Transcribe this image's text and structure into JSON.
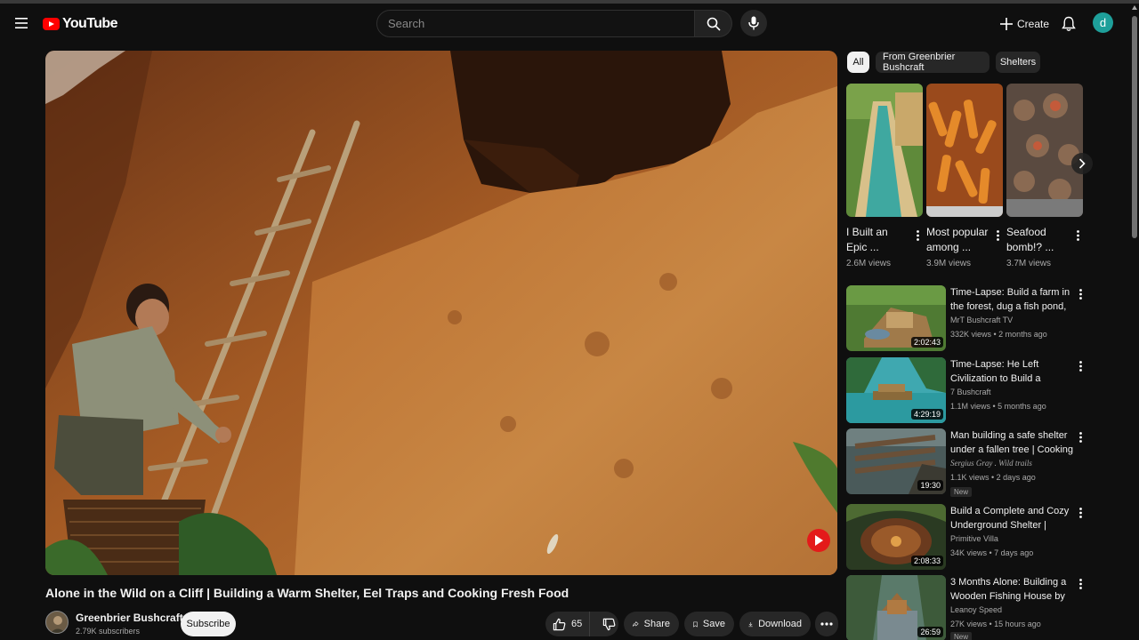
{
  "header": {
    "logo_text": "YouTube",
    "search_placeholder": "Search",
    "create_label": "Create",
    "avatar_letter": "d"
  },
  "video": {
    "title": "Alone in the Wild on a Cliff | Building a Warm Shelter, Eel Traps and Cooking Fresh Food",
    "channel": "Greenbrier Bushcraft",
    "subscribers": "2.79K subscribers",
    "subscribe_label": "Subscribe",
    "likes": "65",
    "share_label": "Share",
    "save_label": "Save",
    "download_label": "Download"
  },
  "chips": [
    "All",
    "From Greenbrier Bushcraft",
    "Shelters"
  ],
  "shorts": [
    {
      "title": "I Built an Epic ...",
      "views": "2.6M views"
    },
    {
      "title": "Most popular among ...",
      "views": "3.9M views"
    },
    {
      "title": "Seafood bomb!? ...",
      "views": "3.7M views"
    }
  ],
  "recommendations": [
    {
      "title": "Time-Lapse: Build a farm in the forest, dug a fish pond, grew ...",
      "channel": "MrT Bushcraft TV",
      "meta": "332K views • 2 months ago",
      "duration": "2:02:43",
      "badge": ""
    },
    {
      "title": "Time-Lapse: He Left Civilization to Build a Floating...",
      "channel": "7 Bushcraft",
      "meta": "1.1M views • 5 months ago",
      "duration": "4:29:19",
      "badge": ""
    },
    {
      "title": "Man building a safe shelter under a fallen tree | Cooking ...",
      "channel": "Sergius Gray . Wild trails",
      "meta": "1.1K views • 2 days ago",
      "duration": "19:30",
      "badge": "New"
    },
    {
      "title": "Build a Complete and Cozy Underground Shelter | Primitiv...",
      "channel": "Primitive Villa",
      "meta": "34K views • 7 days ago",
      "duration": "2:08:33",
      "badge": ""
    },
    {
      "title": "3 Months Alone: Building a Wooden Fishing House by the ...",
      "channel": "Leanoy Speed",
      "meta": "27K views • 15 hours ago",
      "duration": "26:59",
      "badge": "New"
    }
  ],
  "colors": {
    "background": "#0f0f0f",
    "brand_red": "#ff0000",
    "avatar": "#1e9f9a",
    "pill": "#272727"
  },
  "icons": [
    "menu-icon",
    "youtube-logo-icon",
    "search-icon",
    "mic-icon",
    "plus-icon",
    "bell-icon",
    "thumbs-up-icon",
    "thumbs-down-icon",
    "share-icon",
    "save-icon",
    "download-icon",
    "more-icon",
    "chevron-right-icon",
    "kebab-icon"
  ]
}
